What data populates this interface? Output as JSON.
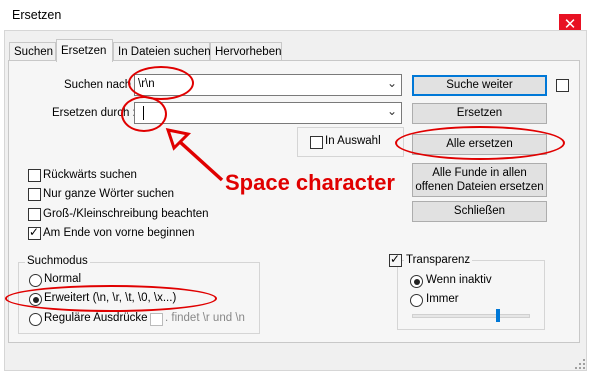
{
  "window": {
    "title": "Ersetzen",
    "close_glyph": "✕"
  },
  "tabs": [
    "Suchen",
    "Ersetzen",
    "In Dateien suchen",
    "Hervorheben"
  ],
  "find": {
    "label": "Suchen nach :",
    "value": "\\r\\n"
  },
  "replace": {
    "label": "Ersetzen durch :",
    "value": ""
  },
  "buttons": {
    "find_next": "Suche weiter",
    "replace": "Ersetzen",
    "replace_all": "Alle ersetzen",
    "replace_all_open": "Alle Funde in allen offenen Dateien ersetzen",
    "close": "Schließen"
  },
  "in_selection": "In Auswahl",
  "options": [
    {
      "label": "Rückwärts suchen",
      "checked": false
    },
    {
      "label": "Nur ganze Wörter suchen",
      "checked": false
    },
    {
      "label": "Groß-/Kleinschreibung beachten",
      "checked": false
    },
    {
      "label": "Am Ende von vorne beginnen",
      "checked": true
    }
  ],
  "search_mode": {
    "legend": "Suchmodus",
    "normal": "Normal",
    "extended": "Erweitert (\\n, \\r, \\t, \\0, \\x...)",
    "regex": "Reguläre Ausdrücke",
    "dot_newline": ". findet \\r und \\n",
    "selected": "extended"
  },
  "transparency": {
    "label": "Transparenz",
    "checked": true,
    "when_inactive": "Wenn inaktiv",
    "always": "Immer",
    "slider_value": 0.72
  },
  "annotation": {
    "text": "Space character",
    "color": "#e00000"
  }
}
